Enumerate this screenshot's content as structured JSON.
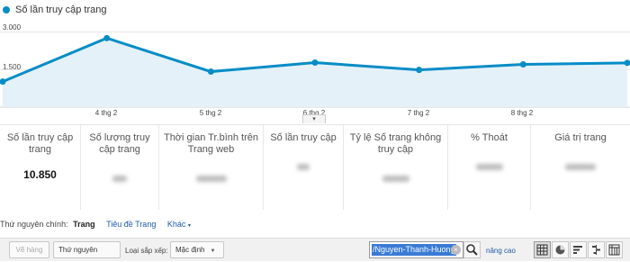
{
  "chart_data": {
    "type": "area",
    "series": [
      {
        "name": "Số lần truy cập trang",
        "values": [
          1020,
          2760,
          1420,
          1780,
          1490,
          1710,
          1770
        ]
      }
    ],
    "x_labels": [
      "4 thg 2",
      "5 thg 2",
      "6 thg 2",
      "7 thg 2",
      "8 thg 2"
    ],
    "y_ticks": [
      "3.000",
      "1.500"
    ],
    "ylim": [
      0,
      3600
    ],
    "color": "#058dc7",
    "fill": "#e5f1f8",
    "grid": true,
    "legend": "top-left"
  },
  "scorecards": [
    {
      "title": "Số lần truy cập trang",
      "value": "10.850"
    },
    {
      "title": "Số lượng truy cập trang",
      "value": ""
    },
    {
      "title": "Thời gian Tr.bình trên Trang web",
      "value": ""
    },
    {
      "title": "Số lần truy cập",
      "value": ""
    },
    {
      "title": "Tỷ lệ Số trang không truy cập",
      "value": ""
    },
    {
      "title": "% Thoát",
      "value": ""
    },
    {
      "title": "Giá trị trang",
      "value": ""
    }
  ],
  "dimensions": {
    "label": "Thứ nguyên chính:",
    "active": "Trang",
    "options": [
      "Tiêu đề Trang",
      "Khác"
    ]
  },
  "toolbar": {
    "plot_rows": "Vẽ hàng",
    "secondary_dimension": "Thứ nguyên phụ",
    "sort_type_label": "Loại sắp xếp:",
    "sort_value": "Mặc định",
    "search_value": "/Nguyen-Thanh-Huong",
    "advanced": "nâng cao"
  },
  "icons": {
    "search": "search-icon",
    "clear": "clear-icon",
    "views": [
      "table-view-icon",
      "pie-view-icon",
      "performance-view-icon",
      "comparison-view-icon",
      "pivot-view-icon"
    ]
  }
}
